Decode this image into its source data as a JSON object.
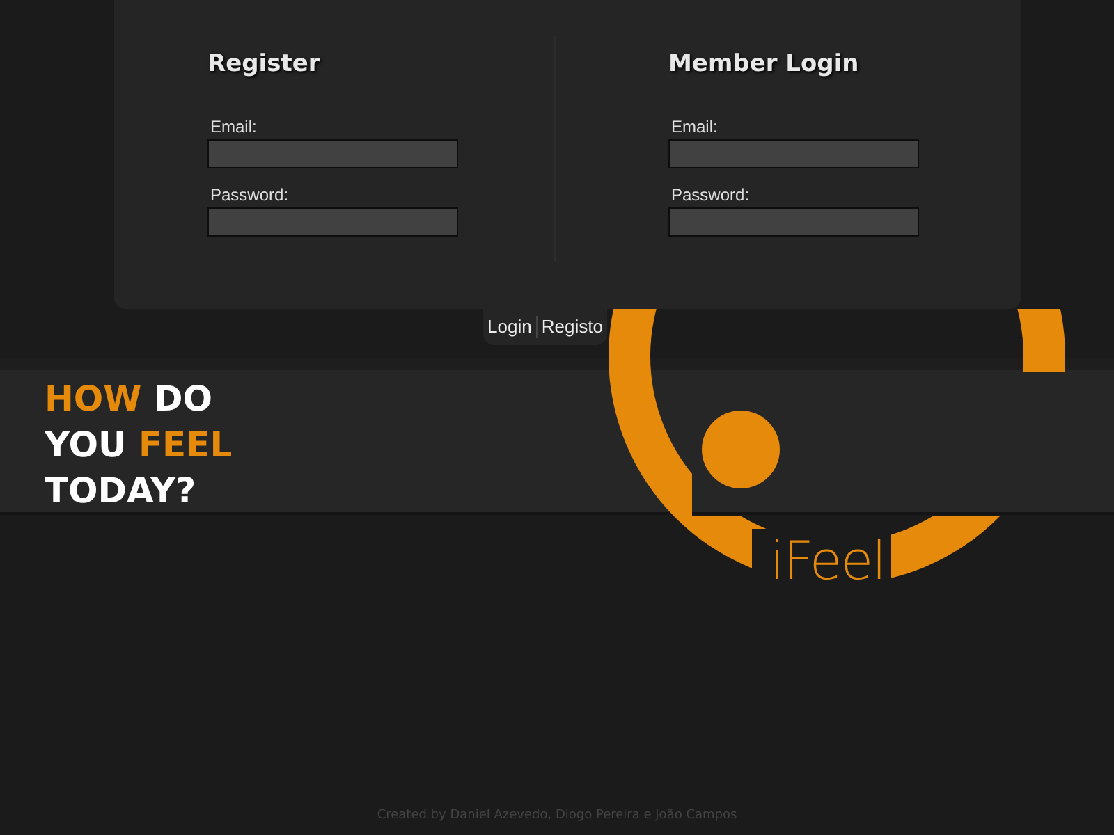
{
  "forms": [
    {
      "title": "Register",
      "fields": [
        {
          "label": "Email:"
        },
        {
          "label": "Password:"
        }
      ]
    },
    {
      "title": "Member Login",
      "fields": [
        {
          "label": "Email:"
        },
        {
          "label": "Password:"
        }
      ]
    }
  ],
  "tabs": [
    {
      "label": "Login"
    },
    {
      "label": "Registo"
    }
  ],
  "tagline": [
    [
      {
        "text": "HOW",
        "accent": true
      },
      {
        "text": "DO",
        "accent": false
      }
    ],
    [
      {
        "text": "YOU",
        "accent": false
      },
      {
        "text": "FEEL",
        "accent": true
      }
    ],
    [
      {
        "text": "TODAY?",
        "accent": false
      }
    ]
  ],
  "logo": {
    "text": "iFeel"
  },
  "footer": "Created by Daniel Azevedo, Diogo Pereira e João Campos"
}
